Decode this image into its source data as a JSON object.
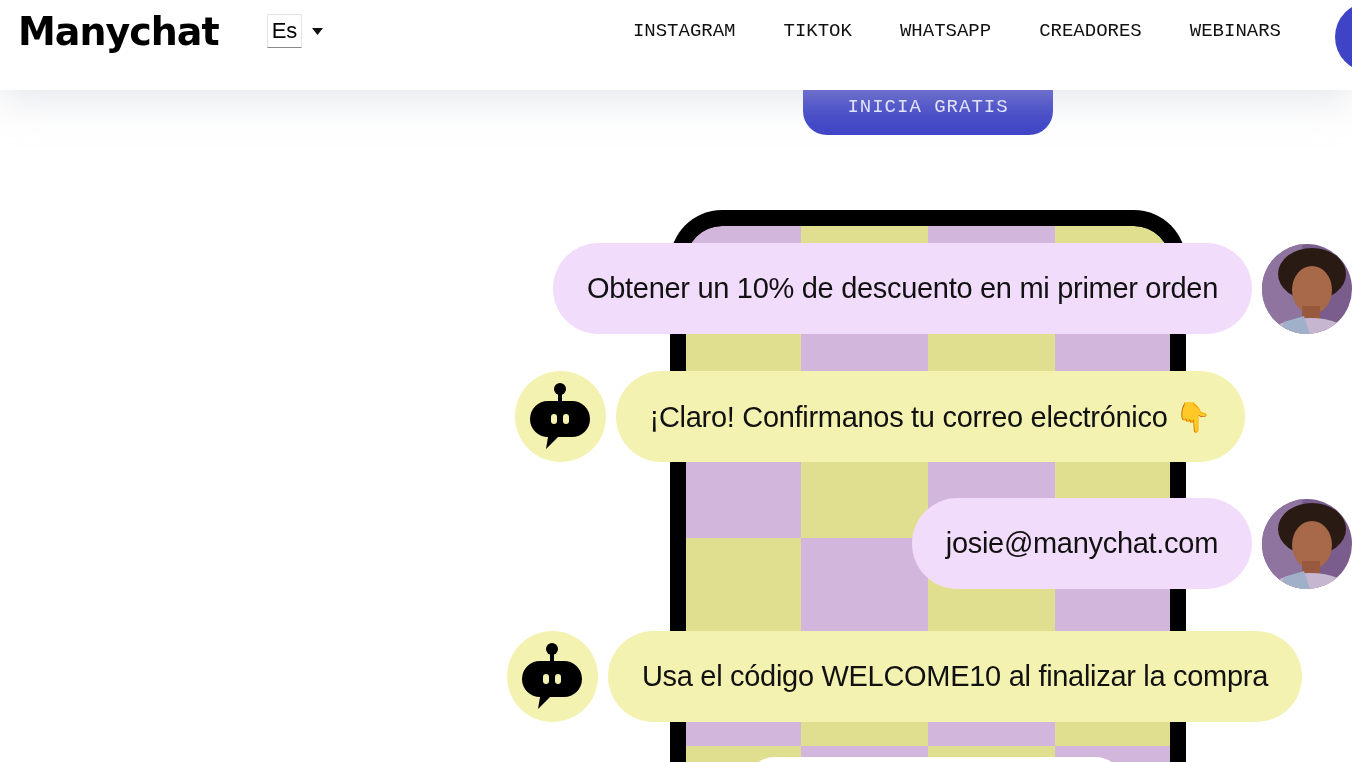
{
  "header": {
    "logo": "Manychat",
    "language": {
      "value": "Es"
    },
    "nav": [
      "INSTAGRAM",
      "TIKTOK",
      "WHATSAPP",
      "CREADORES",
      "WEBINARS"
    ]
  },
  "cta": "INICIA GRATIS",
  "chat": [
    {
      "kind": "user",
      "text": "Obtener un 10% de descuento en mi primer orden"
    },
    {
      "kind": "bot",
      "text": "¡Claro! Confirmanos tu correo electrónico 👇"
    },
    {
      "kind": "user",
      "text": "josie@manychat.com"
    },
    {
      "kind": "bot",
      "text": "Usa el código WELCOME10 al finalizar la compra"
    }
  ]
}
